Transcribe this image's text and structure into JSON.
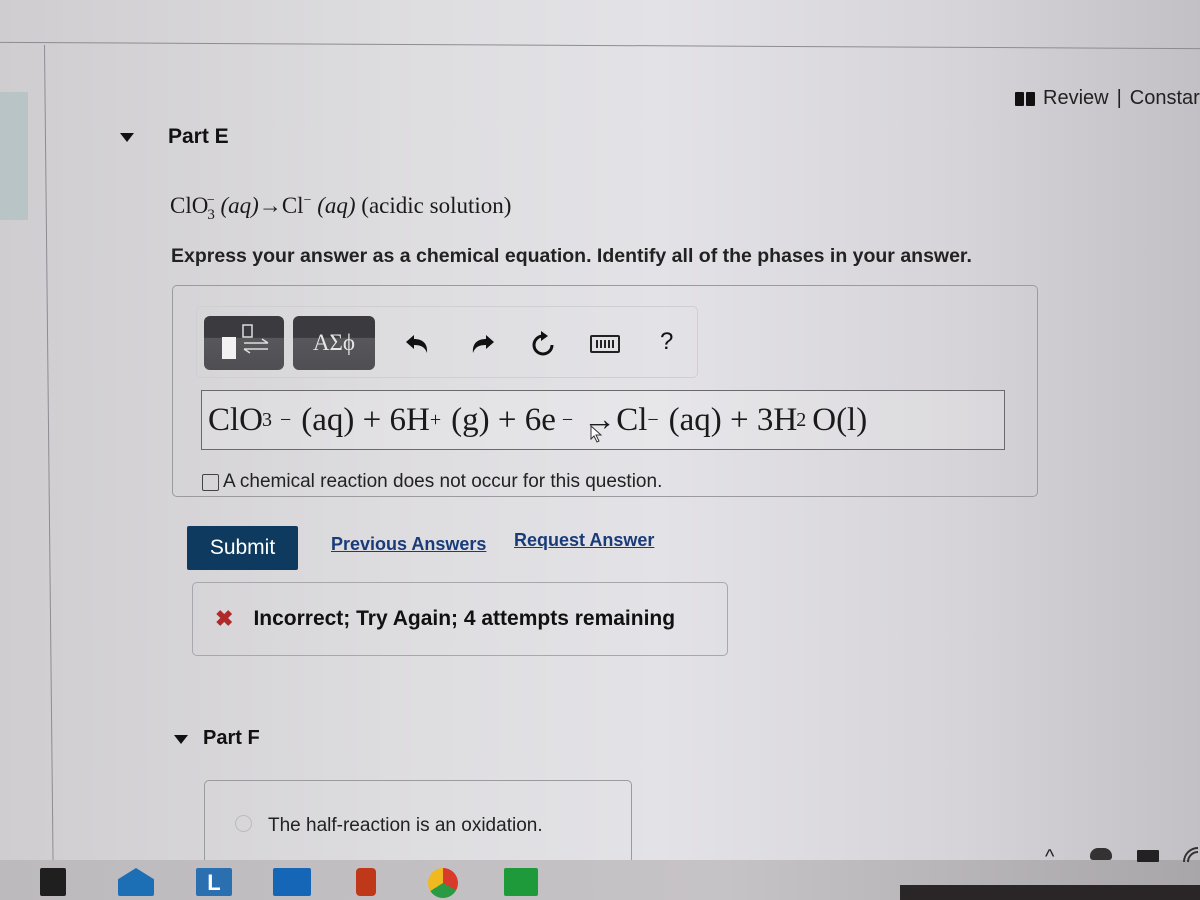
{
  "header": {
    "review_label": "Review",
    "separator": "|",
    "constants_label": "Constar"
  },
  "part_e": {
    "title": "Part E",
    "question": {
      "reactant": "ClO",
      "reactant_sub": "3",
      "reactant_sup": "−",
      "reactant_phase": "(aq)",
      "arrow": "→",
      "product": "Cl",
      "product_sup": "−",
      "product_phase": "(aq)",
      "condition": "(acidic solution)"
    },
    "instructions": "Express your answer as a chemical equation. Identify all of the phases in your answer.",
    "toolbar": {
      "templates_label": "templates",
      "greek_label": "ΑΣϕ",
      "undo": "undo-icon",
      "redo": "redo-icon",
      "reset": "reset-icon",
      "keyboard": "keyboard-icon",
      "help_label": "?"
    },
    "answer": {
      "t1": "ClO",
      "t1_sub": "3",
      "t1_sup": "−",
      "t1_phase": "(aq) + 6H",
      "t2_sup": "+",
      "t2_phase": "(g) + 6e",
      "t3_sup": "−",
      "t3": "→Cl",
      "t4_sup": "−",
      "t4": "(aq) + 3H",
      "t5_sub": "2",
      "t5": "O(l)"
    },
    "no_reaction_checkbox": {
      "label": "A chemical reaction does not occur for this question.",
      "checked": false
    },
    "submit_label": "Submit",
    "previous_answers_label": "Previous Answers",
    "request_answer_label": "Request Answer",
    "feedback": {
      "icon": "✖",
      "text": "Incorrect; Try Again; 4 attempts remaining"
    }
  },
  "part_f": {
    "title": "Part F",
    "option_label": "The half-reaction is an oxidation."
  },
  "colors": {
    "submit_bg": "#0e3a5f",
    "link": "#1a3b79",
    "error": "#b02a2a"
  },
  "taskbar": {
    "apps": [
      "store-icon",
      "mail-icon",
      "l-app-icon",
      "cortana-icon",
      "office-icon",
      "chrome-icon",
      "green-app-icon"
    ],
    "tray": [
      "chevron-up-icon",
      "onedrive-icon",
      "battery-icon",
      "wifi-icon"
    ],
    "chevron_glyph": "^"
  }
}
